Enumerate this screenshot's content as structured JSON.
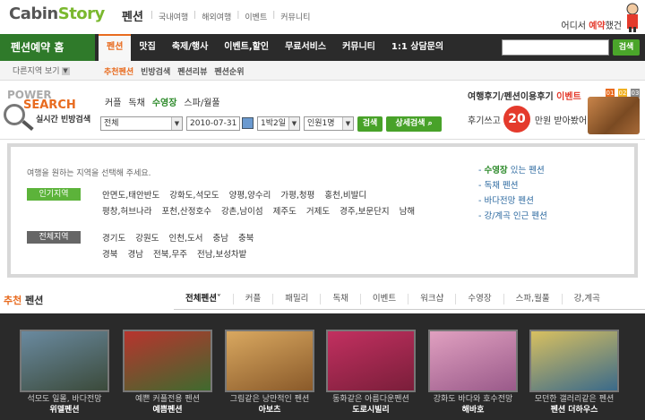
{
  "header": {
    "logo_part1": "Cabin",
    "logo_part2": "Story",
    "logo_sub": "펜션",
    "topnav": [
      "국내여행",
      "해외여행",
      "이벤트",
      "커뮤니티"
    ],
    "event_text_pre": "어디서 ",
    "event_text_hl": "예약",
    "event_text_post": "했건"
  },
  "mainnav": {
    "home_label": "펜션예약 홈",
    "items": [
      "펜션",
      "맛집",
      "축제/행사",
      "이벤트,할인",
      "무료서비스",
      "커뮤니티",
      "1:1 상담문의"
    ],
    "search_button": "검색"
  },
  "subnav": {
    "region_select": "다른지역 보기",
    "items": [
      "추천펜션",
      "빈방검색",
      "펜션리뷰",
      "펜션순위"
    ]
  },
  "search": {
    "title_power": "POWER",
    "title_search": "SEARCH",
    "subtitle": "실시간 빈방검색",
    "tabs": [
      "커플",
      "독채",
      "수영장",
      "스파/월풀"
    ],
    "region_value": "전체",
    "date_value": "2010-07-31",
    "nights_value": "1박2일",
    "people_value": "인원1명",
    "search_btn": "검색",
    "detail_btn": "상세검색"
  },
  "review_banner": {
    "line1_pre": "여행후기/펜션이용후기 ",
    "line1_ev": "이벤트",
    "line2": "후기쓰고",
    "line2_post": "만원 받아봤어?",
    "amount": "20",
    "pages": [
      "01",
      "02",
      "03"
    ]
  },
  "regions": {
    "desc": "여행을 원하는 지역을 선택해 주세요.",
    "popular_label": "인기지역",
    "popular_row1": [
      "안면도,태안반도",
      "강화도,석모도",
      "양평,양수리",
      "가평,청평",
      "홍천,비발디"
    ],
    "popular_row2": [
      "평창,허브나라",
      "포천,산정호수",
      "강촌,남이섬",
      "제주도",
      "거제도",
      "경주,보문단지",
      "남해"
    ],
    "all_label": "전체지역",
    "all_row1": [
      "경기도",
      "강원도",
      "인천,도서",
      "충남",
      "충북"
    ],
    "all_row2": [
      "경북",
      "경남",
      "전북,무주",
      "전남,보성차밭"
    ],
    "links": [
      "수영장",
      "독채 펜션",
      "바다전망 펜션",
      "강/계곡 인근 펜션"
    ],
    "link0_post": " 있는 펜션"
  },
  "recommend": {
    "title_hl": "추천",
    "title": " 펜션",
    "tabs": [
      "전체펜션",
      "커플",
      "패밀리",
      "독채",
      "이벤트",
      "워크샵",
      "수영장",
      "스파,월풀",
      "강,계곡"
    ]
  },
  "photos": [
    {
      "caption": "석모도 일몰, 바다전망",
      "name": "위델펜션",
      "color1": "#6a8aa0",
      "color2": "#3b4a3a"
    },
    {
      "caption": "예쁜 커플전용 펜션",
      "name": "예쁨펜션",
      "color1": "#b8342e",
      "color2": "#3f6a2e"
    },
    {
      "caption": "그림같은 낭만적인 펜션",
      "name": "아보츠",
      "color1": "#d9a860",
      "color2": "#8a5a2a"
    },
    {
      "caption": "동화같은 아름다운펜션",
      "name": "도로시빌리",
      "color1": "#c23060",
      "color2": "#7a1e3a"
    },
    {
      "caption": "강화도 바다와 호수전망",
      "name": "해바호",
      "color1": "#e0a0c0",
      "color2": "#9a5a8a"
    },
    {
      "caption": "모던한 갤러리같은 펜션",
      "name": "펜션 더하우스",
      "color1": "#d8c060",
      "color2": "#3a6a8a"
    }
  ]
}
